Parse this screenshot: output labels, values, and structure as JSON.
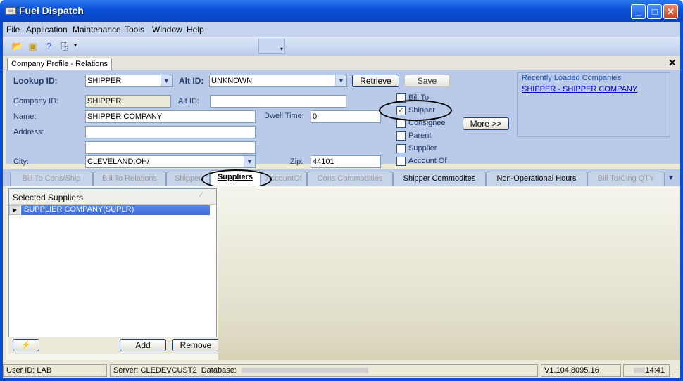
{
  "window": {
    "title": "Fuel Dispatch"
  },
  "menu": [
    "File",
    "Application",
    "Maintenance",
    "Tools",
    "Window",
    "Help"
  ],
  "doc_tab": {
    "label": "Company Profile - Relations"
  },
  "lookup": {
    "label": "Lookup ID:",
    "value": "SHIPPER",
    "alt_label": "Alt ID:",
    "alt_value": "UNKNOWN",
    "retrieve": "Retrieve",
    "save": "Save"
  },
  "company": {
    "company_id_label": "Company ID:",
    "company_id": "SHIPPER",
    "alt_id_label": "Alt ID:",
    "alt_id": "",
    "name_label": "Name:",
    "name": "SHIPPER COMPANY",
    "dwell_label": "Dwell Time:",
    "dwell": "0",
    "address_label": "Address:",
    "address1": "",
    "address2": "",
    "city_label": "City:",
    "city": "CLEVELAND,OH/",
    "zip_label": "Zip:",
    "zip": "44101"
  },
  "checkboxes": [
    {
      "label": "Bill To",
      "checked": false
    },
    {
      "label": "Shipper",
      "checked": true
    },
    {
      "label": "Consignee",
      "checked": false
    },
    {
      "label": "Parent",
      "checked": false
    },
    {
      "label": "Supplier",
      "checked": false
    },
    {
      "label": "Account Of",
      "checked": false
    }
  ],
  "more_button": "More >>",
  "recent": {
    "title": "Recently Loaded Companies",
    "link": "SHIPPER - SHIPPER COMPANY"
  },
  "tabs": [
    "Bill To Cons/Ship",
    "Bill To Relations",
    "Shipper",
    "Suppliers",
    "AccountOf",
    "Cons Commodities",
    "Shipper Commodites",
    "Non-Operational Hours",
    "Bill To/Cing QTY"
  ],
  "grid": {
    "header": "Selected Suppliers",
    "rows": [
      "SUPPLIER COMPANY(SUPLR)"
    ]
  },
  "grid_buttons": {
    "add": "Add",
    "remove": "Remove"
  },
  "status": {
    "user": "User ID: LAB",
    "server": "Server: CLEDEVCUST2",
    "database": "Database:",
    "version": "V1.104.8095.16",
    "time": "14:41"
  },
  "colors": {
    "titlebar": "#0a52d8",
    "form_bg": "#b9cbe8",
    "selected_row": "#3d6be0"
  }
}
